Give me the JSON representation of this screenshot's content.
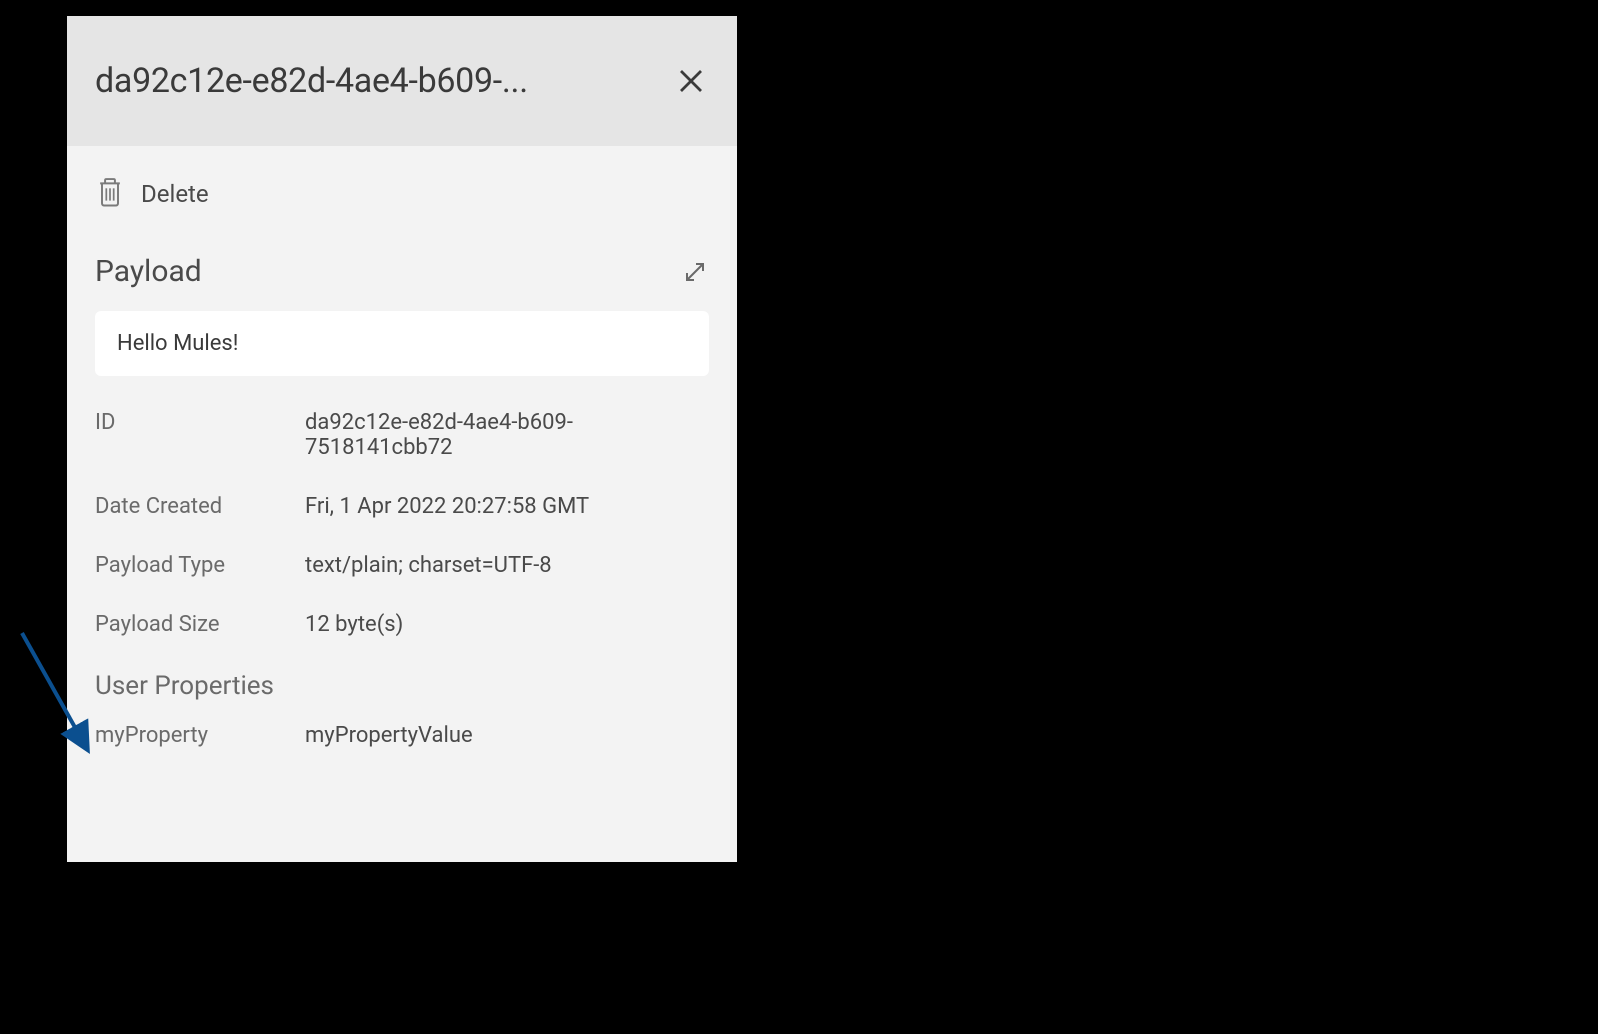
{
  "header": {
    "title_truncated": "da92c12e-e82d-4ae4-b609-..."
  },
  "actions": {
    "delete_label": "Delete"
  },
  "payload_section": {
    "title": "Payload",
    "content": "Hello Mules!"
  },
  "details": {
    "id_label": "ID",
    "id_value": "da92c12e-e82d-4ae4-b609-7518141cbb72",
    "date_created_label": "Date Created",
    "date_created_value": "Fri, 1 Apr 2022 20:27:58 GMT",
    "payload_type_label": "Payload Type",
    "payload_type_value": "text/plain; charset=UTF-8",
    "payload_size_label": "Payload Size",
    "payload_size_value": "12 byte(s)"
  },
  "user_properties": {
    "title": "User Properties",
    "items": [
      {
        "key": "myProperty",
        "value": "myPropertyValue"
      }
    ]
  }
}
